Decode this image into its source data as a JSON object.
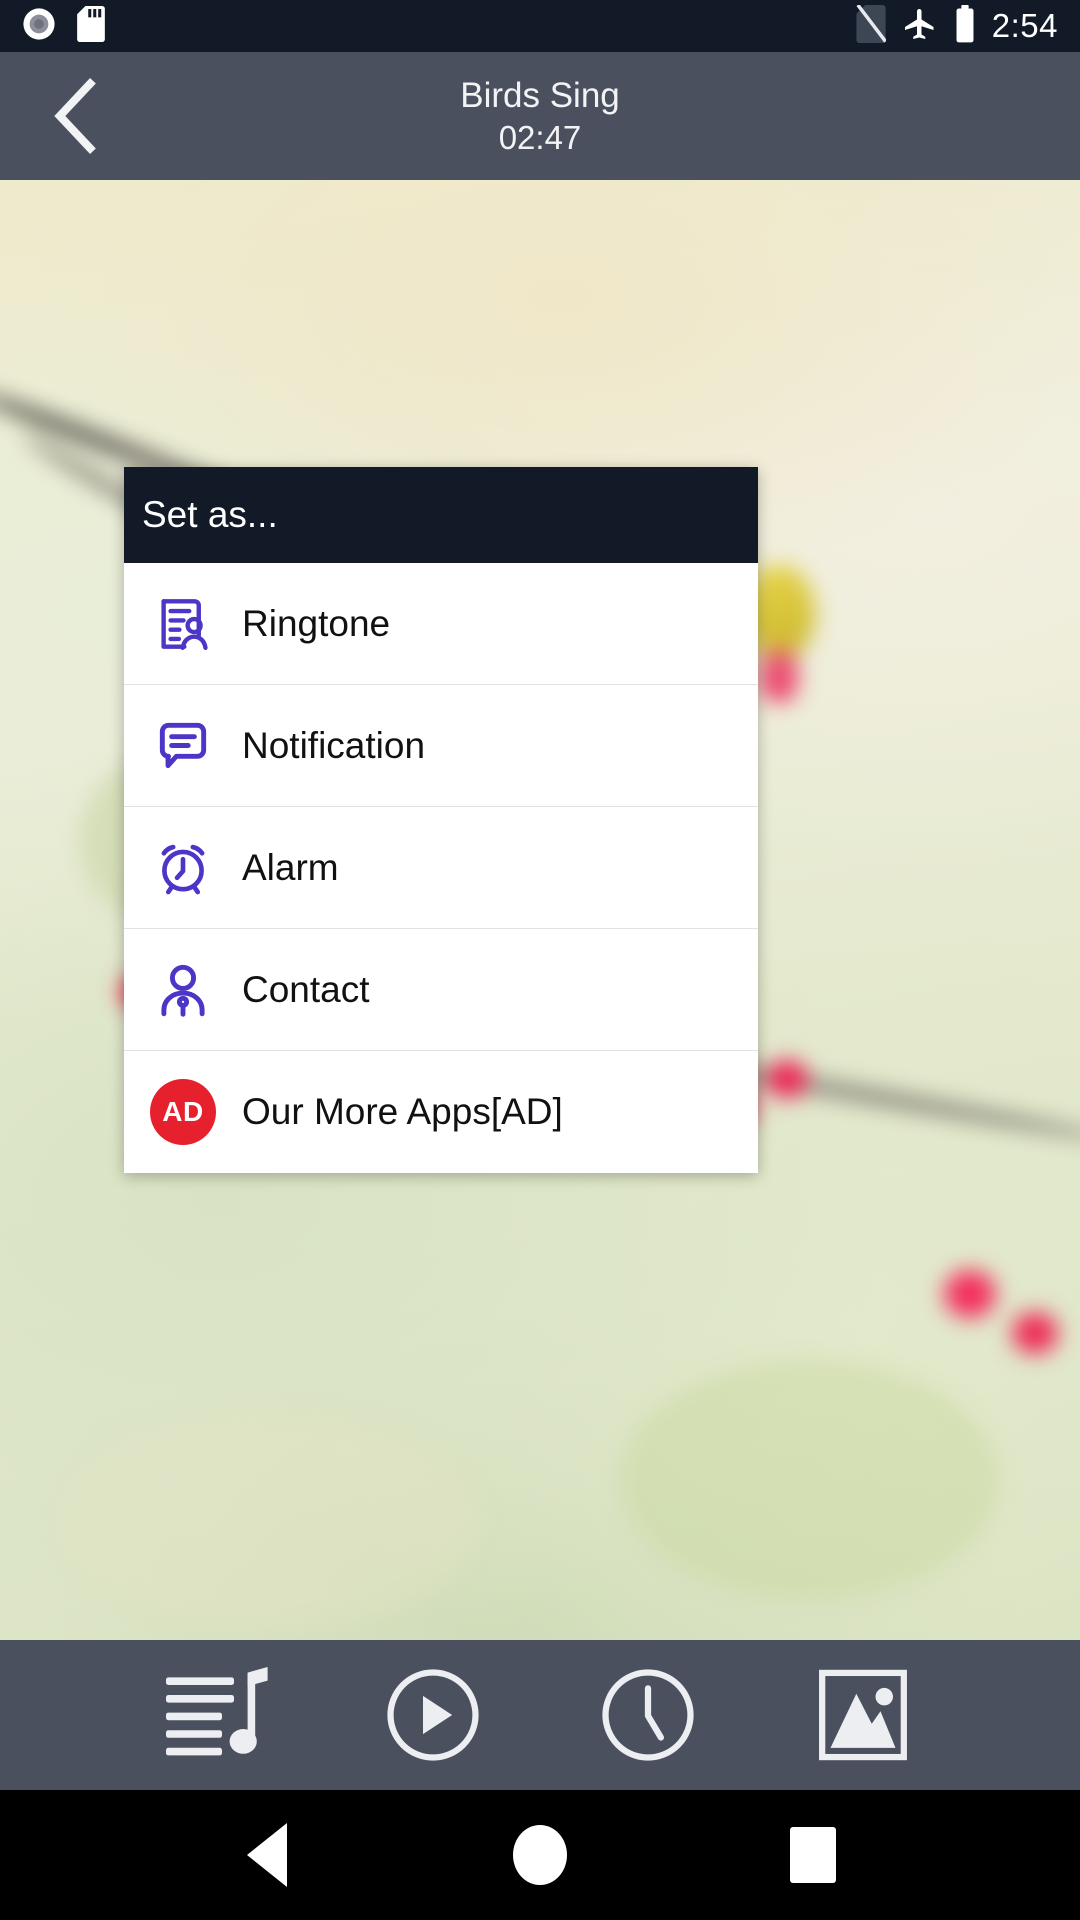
{
  "statusbar": {
    "time": "2:54",
    "icons": [
      "record-disc-icon",
      "sd-card-icon",
      "no-sim-icon",
      "airplane-mode-icon",
      "battery-icon"
    ]
  },
  "appbar": {
    "back_label": "back-icon",
    "title": "Birds Sing",
    "duration": "02:47"
  },
  "dialog": {
    "title": "Set as...",
    "accent_color": "#4b36c8",
    "header_color": "#121a28",
    "ad_color": "#e7202e",
    "items": [
      {
        "label": "Ringtone",
        "icon": "ringtone-contact-card-icon"
      },
      {
        "label": "Notification",
        "icon": "notification-message-icon"
      },
      {
        "label": "Alarm",
        "icon": "alarm-clock-icon"
      },
      {
        "label": "Contact",
        "icon": "contact-person-icon"
      },
      {
        "label": "Our More Apps[AD]",
        "icon": "ad-badge-icon",
        "badge_text": "AD"
      }
    ]
  },
  "toolbar": {
    "items": [
      {
        "name": "playlist-music-icon"
      },
      {
        "name": "play-circle-icon"
      },
      {
        "name": "clock-icon"
      },
      {
        "name": "image-icon"
      }
    ]
  },
  "navbar": {
    "items": [
      {
        "name": "nav-back-icon"
      },
      {
        "name": "nav-home-icon"
      },
      {
        "name": "nav-recents-icon"
      }
    ]
  },
  "wallpaper": {
    "description": "blurred photo of a branch with red berries and a yellow bird"
  }
}
